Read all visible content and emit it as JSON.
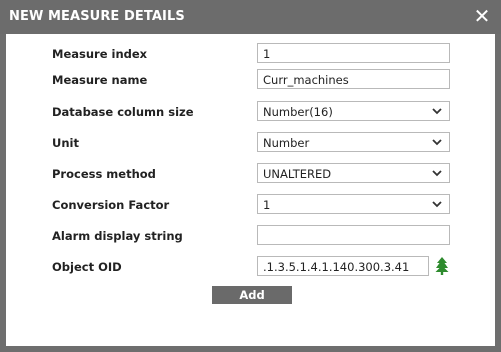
{
  "dialog": {
    "title": "NEW MEASURE DETAILS",
    "close_icon": "close-icon"
  },
  "form": {
    "measure_index": {
      "label": "Measure index",
      "value": "1"
    },
    "measure_name": {
      "label": "Measure name",
      "value": "Curr_machines"
    },
    "database_column_size": {
      "label": "Database column size",
      "value": "Number(16)"
    },
    "unit": {
      "label": "Unit",
      "value": "Number"
    },
    "process_method": {
      "label": "Process method",
      "value": "UNALTERED"
    },
    "conversion_factor": {
      "label": "Conversion Factor",
      "value": "1"
    },
    "alarm_display_string": {
      "label": "Alarm display string",
      "value": ""
    },
    "object_oid": {
      "label": "Object OID",
      "value": ".1.3.5.1.4.1.140.300.3.41",
      "browse_icon": "tree-icon"
    }
  },
  "buttons": {
    "add_label": "Add"
  },
  "colors": {
    "titlebar": "#6c6c6c",
    "button": "#6a6a6a",
    "tree_icon": "#2e8b2e"
  }
}
